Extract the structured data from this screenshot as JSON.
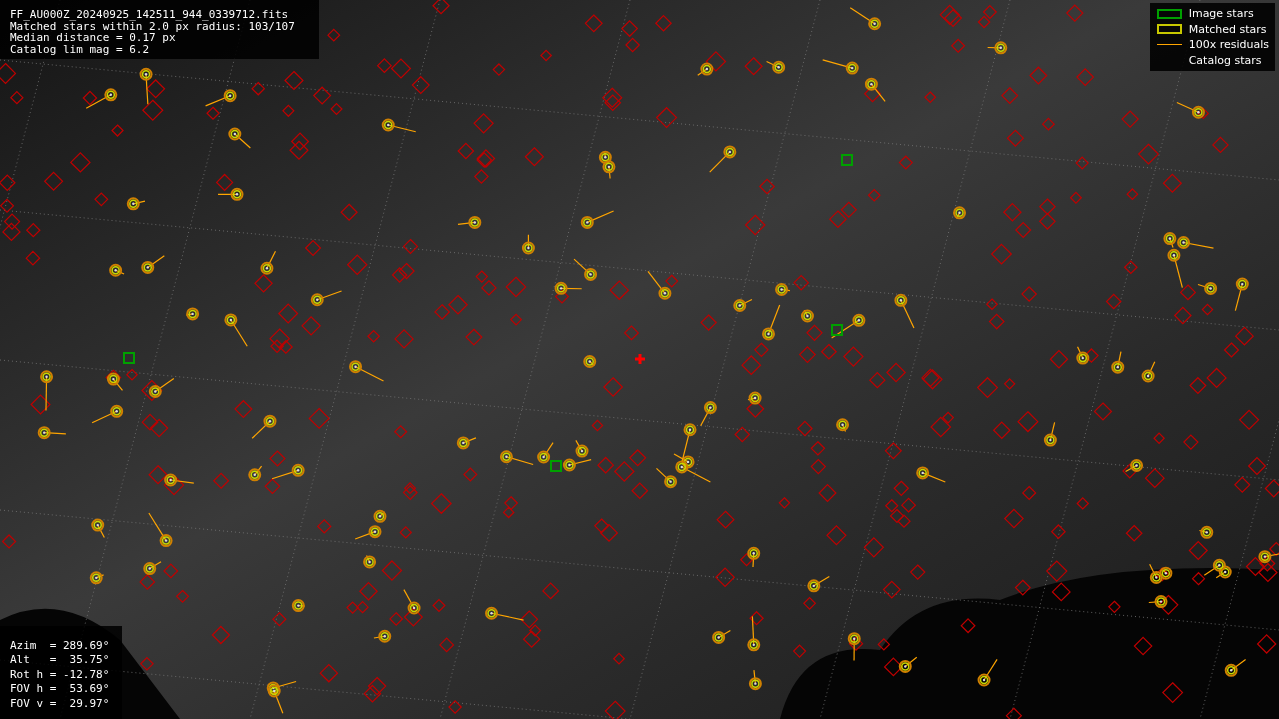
{
  "info": {
    "lines": [
      "FF_AU000Z_20240925_142511_944_0339712.fits",
      "Matched stars within 2.0 px radius: 103/107",
      "Median distance = 0.17 px",
      "Catalog lim mag = 6.2"
    ]
  },
  "legend": {
    "items": [
      {
        "label": "Image stars",
        "kind": "box",
        "color": "#00a000"
      },
      {
        "label": "Matched stars",
        "kind": "box",
        "color": "#c8c800"
      },
      {
        "label": "100x residuals",
        "kind": "line",
        "color": "#ffa500"
      },
      {
        "label": "Catalog stars",
        "kind": "none"
      }
    ]
  },
  "pointing": {
    "lines": [
      "Azim  = 289.69°",
      "Alt   =  35.75°",
      "Rot h = -12.78°",
      "FOV h =  53.69°",
      "FOV v =  29.97°"
    ]
  }
}
